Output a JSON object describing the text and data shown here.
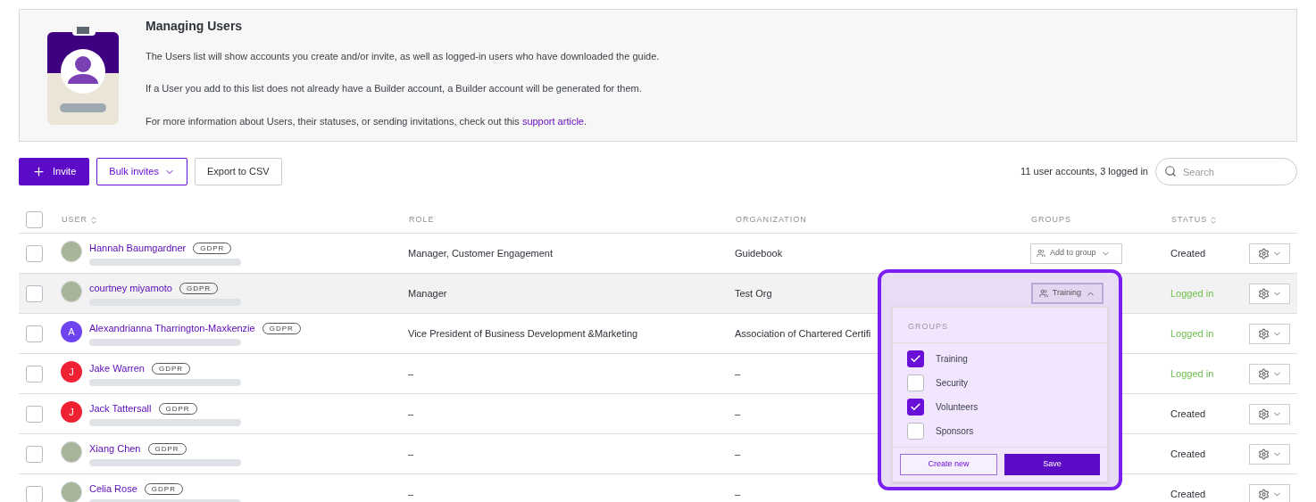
{
  "info": {
    "title": "Managing Users",
    "paragraphs": [
      "The Users list will show accounts you create and/or invite, as well as logged-in users who have downloaded the guide.",
      "If a User you add to this list does not already have a Builder account, a Builder account will be generated for them.",
      {
        "text": "For more information about Users, their statuses, or sending invitations, check out this ",
        "link": "support article",
        "after": "."
      }
    ]
  },
  "toolbar": {
    "invite": "Invite",
    "bulk": "Bulk invites",
    "export": "Export to CSV",
    "summary": "11 user accounts, 3 logged in",
    "search": {
      "placeholder": "Search"
    }
  },
  "columns": [
    "USER",
    "ROLE",
    "ORGANIZATION",
    "GROUPS",
    "STATUS"
  ],
  "select_all_checked": false,
  "rows": [
    {
      "name": "Hannah Baumgardner",
      "badge": "GDPR",
      "avatar": {
        "kind": "photo"
      },
      "role": "Manager, Customer Engagement",
      "organization": "Guidebook",
      "group": "Add to group",
      "status": "Created",
      "logged_in": false,
      "highlighted": false
    },
    {
      "name": "courtney miyamoto",
      "badge": "GDPR",
      "avatar": {
        "kind": "photo"
      },
      "role": "Manager",
      "organization": "Test Org",
      "status": "Logged in",
      "logged_in": true,
      "highlighted": true
    },
    {
      "name": "Alexandrianna Tharrington-Maxkenzie",
      "badge": "GDPR",
      "avatar": {
        "kind": "letter",
        "letter": "A",
        "color": "#6e44f0"
      },
      "role": "Vice President of Business Development &Marketing",
      "organization": "Association of Chartered Certifi",
      "status": "Logged in",
      "logged_in": true,
      "highlighted": false
    },
    {
      "name": "Jake Warren",
      "badge": "GDPR",
      "avatar": {
        "kind": "letter",
        "letter": "J",
        "color": "#ee2233"
      },
      "role": "–",
      "organization": "–",
      "status": "Logged in",
      "logged_in": true,
      "highlighted": false
    },
    {
      "name": "Jack Tattersall",
      "badge": "GDPR",
      "avatar": {
        "kind": "letter",
        "letter": "J",
        "color": "#ee2233"
      },
      "role": "–",
      "organization": "–",
      "status": "Created",
      "logged_in": false,
      "highlighted": false
    },
    {
      "name": "Xiang Chen",
      "badge": "GDPR",
      "avatar": {
        "kind": "photo"
      },
      "role": "–",
      "organization": "–",
      "status": "Created",
      "logged_in": false,
      "highlighted": false
    },
    {
      "name": "Celia Rose",
      "badge": "GDPR",
      "avatar": {
        "kind": "photo"
      },
      "role": "–",
      "organization": "–",
      "status": "Created",
      "logged_in": false,
      "highlighted": false
    }
  ],
  "popover": {
    "button": "Training",
    "expanded": true,
    "heading": "GROUPS",
    "options": [
      {
        "label": "Training",
        "checked": true
      },
      {
        "label": "Security",
        "checked": false
      },
      {
        "label": "Volunteers",
        "checked": true
      },
      {
        "label": "Sponsors",
        "checked": false
      }
    ],
    "create": "Create new",
    "save": "Save"
  }
}
